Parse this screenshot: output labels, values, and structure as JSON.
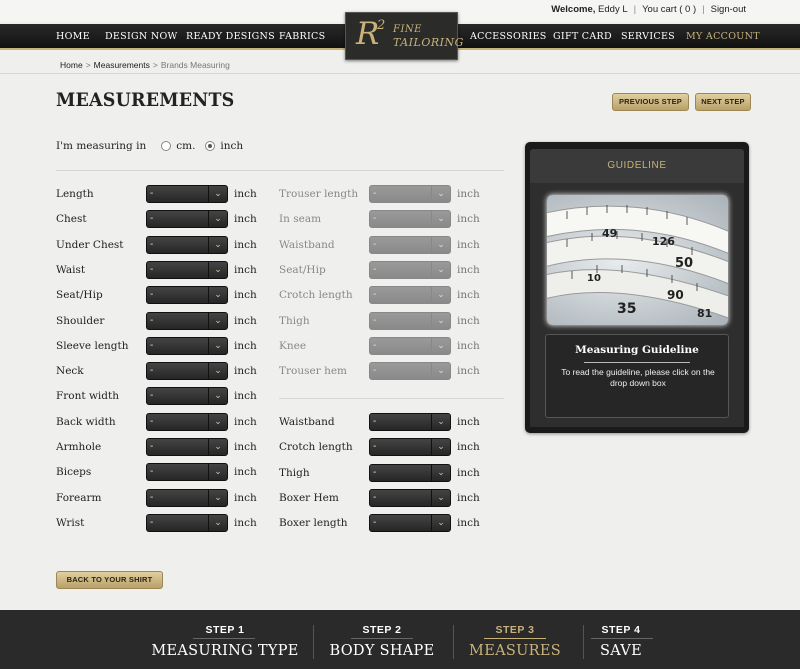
{
  "header": {
    "welcome": "Welcome,",
    "user": "Eddy L",
    "cart": "You cart ( 0 )",
    "signout": "Sign-out",
    "nav_left": [
      "HOME",
      "DESIGN NOW",
      "READY DESIGNS",
      "FABRICS"
    ],
    "nav_right": [
      "ACCESSORIES",
      "GIFT CARD",
      "SERVICES",
      "MY ACCOUNT"
    ],
    "logo": {
      "r": "R",
      "sup": "2",
      "line1": "FINE",
      "line2": "TAILORING"
    }
  },
  "breadcrumb": {
    "home": "Home",
    "measurements": "Measurements",
    "current": "Brands Measuring",
    "sep": ">"
  },
  "page": {
    "title": "MEASUREMENTS",
    "prev_label": "PREVIOUS STEP",
    "next_label": "NEXT STEP",
    "measuring_in_label": "I'm measuring in",
    "unit_options": [
      "cm.",
      "inch"
    ],
    "selected_unit": "inch",
    "back_label": "BACK TO YOUR SHIRT"
  },
  "select_placeholder": "-",
  "unit_text": "inch",
  "measurements_left": [
    "Length",
    "Chest",
    "Under Chest",
    "Waist",
    "Seat/Hip",
    "Shoulder",
    "Sleeve length",
    "Neck",
    "Front width",
    "Back width",
    "Armhole",
    "Biceps",
    "Forearm",
    "Wrist"
  ],
  "measurements_right_disabled": [
    "Trouser length",
    "In seam",
    "Waistband",
    "Seat/Hip",
    "Crotch length",
    "Thigh",
    "Knee",
    "Trouser hem"
  ],
  "measurements_right_active": [
    "Waistband",
    "Crotch length",
    "Thigh",
    "Boxer Hem",
    "Boxer length"
  ],
  "guideline": {
    "header": "GUIDELINE",
    "title": "Measuring Guideline",
    "text": "To read the guideline, please click on the drop down box",
    "tape_numbers": [
      "49",
      "126",
      "50",
      "35",
      "10",
      "90",
      "81"
    ]
  },
  "steps": [
    {
      "num": "STEP 1",
      "title": "MEASURING TYPE"
    },
    {
      "num": "STEP 2",
      "title": "BODY SHAPE"
    },
    {
      "num": "STEP 3",
      "title": "MEASURES"
    },
    {
      "num": "STEP 4",
      "title": "SAVE"
    }
  ],
  "current_step": 2,
  "colors": {
    "gold": "#c8b27a",
    "dark": "#2a2a2a",
    "background": "#efefed"
  }
}
